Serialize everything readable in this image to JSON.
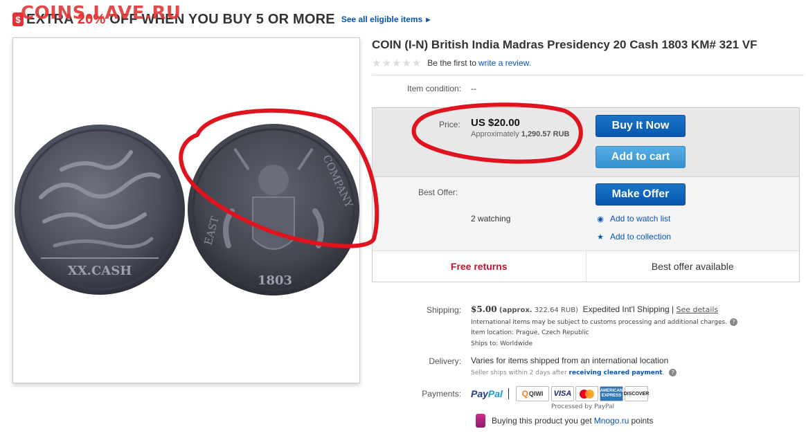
{
  "watermark": "COINS.LAVE.RU",
  "promo": {
    "icon": "dollar-tag-icon",
    "text_start": "EXTRA ",
    "percent": "20%",
    "text_end": " OFF WHEN YOU BUY 5 OR MORE",
    "link": "See all eligible items"
  },
  "coins": {
    "left_denomination": "XX.CASH",
    "right_year": "1803",
    "right_legend_left": "EAST",
    "right_legend_right": "COMPANY"
  },
  "listing": {
    "title": "COIN (I-N) British India Madras Presidency 20 Cash 1803 KM# 321 VF",
    "rating_prefix": "Be the first to",
    "rating_link": "write a review."
  },
  "condition": {
    "label": "Item condition:",
    "value": "--"
  },
  "price": {
    "label": "Price:",
    "main": "US $20.00",
    "approx_prefix": "Approximately ",
    "approx_value": "1,290.57 RUB"
  },
  "buttons": {
    "buy_now": "Buy It Now",
    "add_to_cart": "Add to cart",
    "make_offer": "Make Offer"
  },
  "offer": {
    "label": "Best Offer:",
    "watching": "2 watching",
    "watch_link": "Add to watch list",
    "collection_link": "Add to collection"
  },
  "bottom_row": {
    "free_returns": "Free returns",
    "best_offer": "Best offer available"
  },
  "shipping": {
    "label": "Shipping:",
    "amount": "$5.00",
    "approx_prefix": "(approx.",
    "approx_value": "322.64 RUB)",
    "method": "Expedited Int'l Shipping |",
    "see_details": "See details",
    "note": "International items may be subject to customs processing and additional charges.",
    "location": "Item location:  Prague, Czech Republic",
    "ships_to": "Ships to:  Worldwide"
  },
  "delivery": {
    "label": "Delivery:",
    "main": "Varies for items shipped from an international location",
    "sub_prefix": "Seller ships within 2 days after",
    "sub_link": "receiving cleared payment",
    "sub_suffix": "."
  },
  "payments": {
    "label": "Payments:",
    "paypal_1": "Pay",
    "paypal_2": "Pal",
    "qiwi": "QIWI",
    "visa": "VISA",
    "amex": "AMERICAN EXPRESS",
    "discover": "DISCOVER",
    "mastercard": "MasterCard",
    "processed": "Processed by PayPal"
  },
  "mnogo": {
    "prefix": "Buying this product you get",
    "link": "Mnogo.ru",
    "suffix": "points"
  },
  "colors": {
    "accent_red": "#e53238",
    "link_blue": "#0654ba",
    "button_blue": "#0657b0",
    "cart_blue": "#3591cf",
    "annotation_red": "#e0141e"
  }
}
